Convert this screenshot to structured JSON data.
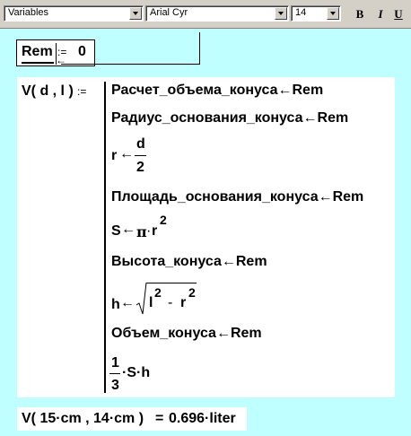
{
  "toolbar": {
    "style_value": "Variables",
    "font_value": "Arial Cyr",
    "size_value": "14",
    "bold_label": "B",
    "italic_label": "I",
    "underline_label": "U"
  },
  "rem_definition": {
    "name": "Rem",
    "assign_op": ":=",
    "value": "0"
  },
  "function_definition": {
    "header": "V( d , l )",
    "assign_op": ":=",
    "arrow": "←",
    "lines": {
      "calc_volume": "Расчет_объема_конуса",
      "radius_base": "Радиус_основания_конуса",
      "r_var": "r",
      "r_num": "d",
      "r_den": "2",
      "area_base": "Площадь_основания_конуса",
      "s_expr_left": "S",
      "s_expr_pi": "π",
      "s_expr_dot": "·",
      "s_expr_r": "r",
      "s_expr_exp": "2",
      "height": "Высота_конуса",
      "h_var": "h",
      "h_l": "l",
      "h_l_exp": "2",
      "h_minus": "-",
      "h_r": "r",
      "h_r_exp": "2",
      "volume": "Объем_конуса",
      "result_num": "1",
      "result_den": "3",
      "result_rest": "·S·h",
      "rem_token": "Rem"
    }
  },
  "evaluation": {
    "expression": "V( 15·cm , 14·cm )",
    "equals": "=",
    "result": "0.696·liter"
  }
}
